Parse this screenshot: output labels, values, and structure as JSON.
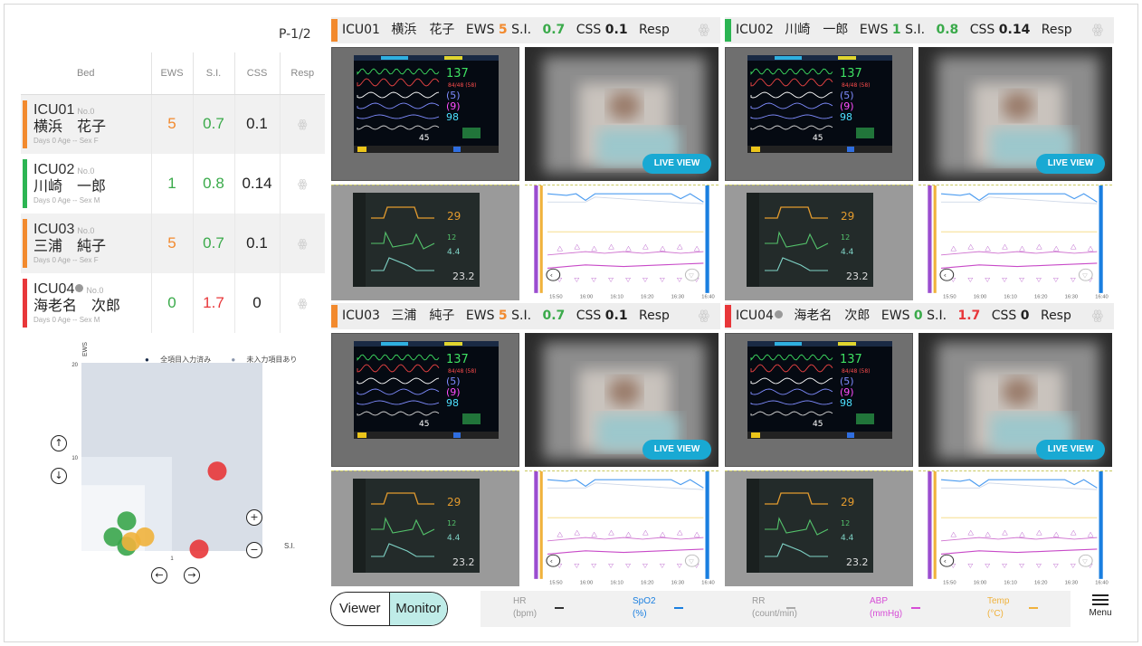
{
  "page_indicator": "P-1/2",
  "table": {
    "headers": [
      "Bed",
      "EWS",
      "S.I.",
      "CSS",
      "Resp"
    ],
    "rows": [
      {
        "bed": "ICU01",
        "no": "No.0",
        "name": "横浜　花子",
        "meta": "Days 0   Age --   Sex F",
        "ews": "5",
        "si": "0.7",
        "css": "0.1",
        "color": "#f28a2e",
        "ews_color": "#f28a2e",
        "si_color": "#3aaa4a"
      },
      {
        "bed": "ICU02",
        "no": "No.0",
        "name": "川崎　一郎",
        "meta": "Days 0   Age --   Sex M",
        "ews": "1",
        "si": "0.8",
        "css": "0.14",
        "color": "#2cb553",
        "ews_color": "#3aaa4a",
        "si_color": "#3aaa4a"
      },
      {
        "bed": "ICU03",
        "no": "No.0",
        "name": "三浦　純子",
        "meta": "Days 0   Age --   Sex F",
        "ews": "5",
        "si": "0.7",
        "css": "0.1",
        "color": "#f28a2e",
        "ews_color": "#f28a2e",
        "si_color": "#3aaa4a"
      },
      {
        "bed": "ICU04",
        "no": "No.0",
        "name": "海老名　次郎",
        "meta": "Days 0   Age --   Sex M",
        "ews": "0",
        "si": "1.7",
        "css": "0",
        "color": "#e8373a",
        "ews_color": "#3aaa4a",
        "si_color": "#e8373a"
      }
    ]
  },
  "scatter": {
    "y_label": "EWS",
    "x_label": "S.I.",
    "y_tick_top": "20",
    "y_tick_mid": "10",
    "x_tick": "1",
    "legend_filled": "全項目入力済み",
    "legend_missing": "未入力項目あり",
    "points": [
      {
        "si": 0.35,
        "ews": 1.5,
        "color": "#3aa64b"
      },
      {
        "si": 0.5,
        "ews": 3.2,
        "color": "#3aa64b"
      },
      {
        "si": 0.5,
        "ews": 0.5,
        "color": "#3aa64b"
      },
      {
        "si": 0.55,
        "ews": 1.0,
        "color": "#f0b23c"
      },
      {
        "si": 0.7,
        "ews": 1.5,
        "color": "#f0b23c"
      },
      {
        "si": 1.5,
        "ews": 8.5,
        "color": "#e8373a"
      },
      {
        "si": 1.3,
        "ews": 0.2,
        "color": "#e8373a"
      }
    ]
  },
  "panels": [
    {
      "bed": "ICU01",
      "name": "横浜　花子",
      "ews": "5",
      "si": "0.7",
      "css": "0.1",
      "ews_color": "#f28a2e",
      "si_color": "#3aaa4a",
      "color": "#f28a2e",
      "info": false
    },
    {
      "bed": "ICU02",
      "name": "川崎　一郎",
      "ews": "1",
      "si": "0.8",
      "css": "0.14",
      "ews_color": "#3aaa4a",
      "si_color": "#3aaa4a",
      "color": "#2cb553",
      "info": false
    },
    {
      "bed": "ICU03",
      "name": "三浦　純子",
      "ews": "5",
      "si": "0.7",
      "css": "0.1",
      "ews_color": "#f28a2e",
      "si_color": "#3aaa4a",
      "color": "#f28a2e",
      "info": false
    },
    {
      "bed": "ICU04",
      "name": "海老名　次郎",
      "ews": "0",
      "si": "1.7",
      "css": "0",
      "ews_color": "#3aaa4a",
      "si_color": "#e8373a",
      "color": "#e8373a",
      "info": true
    }
  ],
  "labels": {
    "ews": "EWS",
    "si": "S.I.",
    "css": "CSS",
    "resp": "Resp",
    "live_view": "LIVE VIEW",
    "viewer": "Viewer",
    "monitor": "Monitor",
    "menu": "Menu"
  },
  "monitor_values": {
    "hr": "137",
    "bp": "84/48 (58)",
    "v1": "(5)",
    "v2": "(9)",
    "spo2": "98",
    "rr": "45"
  },
  "trend_times": [
    "15:50",
    "16:00",
    "16:10",
    "16:20",
    "16:30",
    "16:40"
  ],
  "vitals": [
    {
      "name": "HR",
      "unit": "(bpm)",
      "color": "#888888"
    },
    {
      "name": "SpO2",
      "unit": "(%)",
      "color": "#1a7fe0"
    },
    {
      "name": "RR",
      "unit": "(count/min)",
      "color": "#aaaaaa"
    },
    {
      "name": "ABP",
      "unit": "(mmHg)",
      "color": "#d64dd6"
    },
    {
      "name": "Temp",
      "unit": "(°C)",
      "color": "#f0b23c"
    }
  ]
}
